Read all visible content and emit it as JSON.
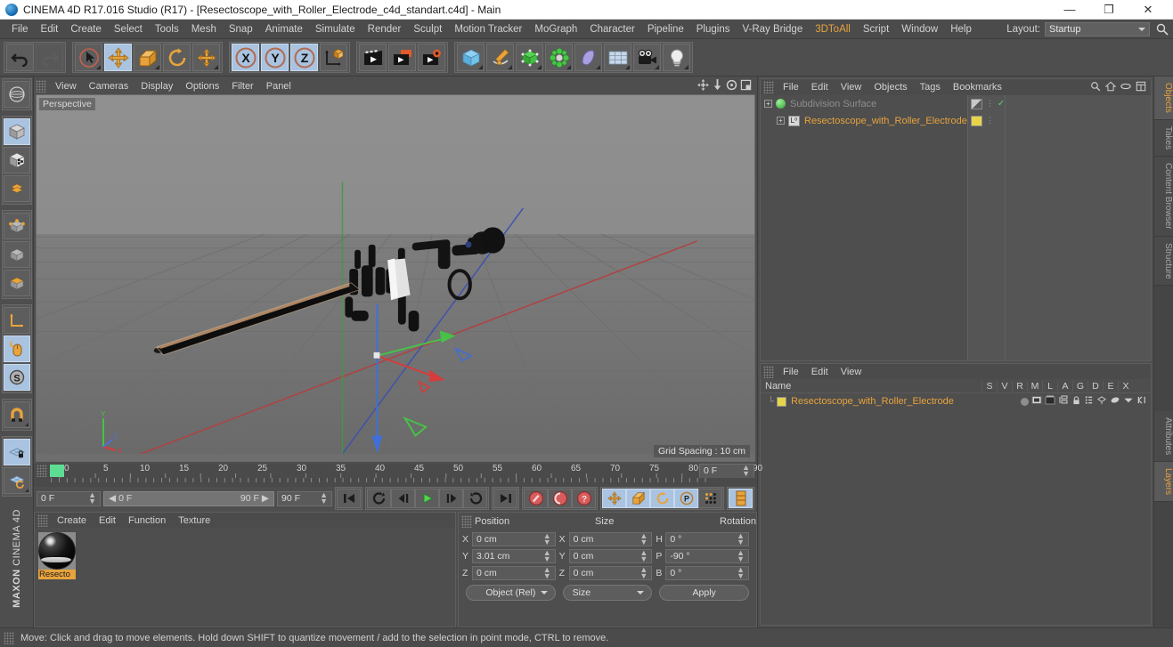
{
  "window": {
    "title": "CINEMA 4D R17.016 Studio (R17) - [Resectoscope_with_Roller_Electrode_c4d_standart.c4d] - Main",
    "minimize": "—",
    "maximize": "❐",
    "close": "✕"
  },
  "menubar": {
    "items": [
      {
        "label": "File"
      },
      {
        "label": "Edit"
      },
      {
        "label": "Create"
      },
      {
        "label": "Select"
      },
      {
        "label": "Tools"
      },
      {
        "label": "Mesh"
      },
      {
        "label": "Snap"
      },
      {
        "label": "Animate"
      },
      {
        "label": "Simulate"
      },
      {
        "label": "Render"
      },
      {
        "label": "Sculpt"
      },
      {
        "label": "Motion Tracker"
      },
      {
        "label": "MoGraph"
      },
      {
        "label": "Character"
      },
      {
        "label": "Pipeline"
      },
      {
        "label": "Plugins"
      },
      {
        "label": "V-Ray Bridge"
      },
      {
        "label": "3DToAll"
      },
      {
        "label": "Script"
      },
      {
        "label": "Window"
      },
      {
        "label": "Help"
      }
    ],
    "layout_label": "Layout:",
    "layout_value": "Startup",
    "search_icon": "search-icon"
  },
  "toolbar": {
    "undo": "undo-arrow-icon",
    "redo": "redo-arrow-icon",
    "live_select": "live-selection-icon",
    "move": "move-tool-icon",
    "scale": "scale-tool-icon",
    "rotate": "rotate-tool-icon",
    "move_alt": "move-alt-tool-icon",
    "axis_x": "X",
    "axis_y": "Y",
    "axis_z": "Z",
    "world_object": "world-object-axis-icon",
    "render_view": "render-view-icon",
    "render_region": "render-to-picture-viewer-icon",
    "render_settings": "render-settings-icon",
    "cube": "cube-primitive-icon",
    "spline": "pen-spline-icon",
    "nurbs": "generator-nurbs-icon",
    "array": "array-deformer-icon",
    "deformer": "bend-deformer-icon",
    "environment": "floor-environment-icon",
    "camera": "camera-icon",
    "light": "light-bulb-icon"
  },
  "left_rail": {
    "items": [
      {
        "name": "texture-axis-icon",
        "active": false
      },
      {
        "name": "model-mode-icon",
        "active": true
      },
      {
        "name": "texture-mode-icon",
        "active": false
      },
      {
        "name": "polygon-grid-icon",
        "active": false
      },
      {
        "name": "points-mode-icon",
        "active": false
      },
      {
        "name": "edges-mode-icon",
        "active": false
      },
      {
        "name": "polygons-mode-icon",
        "active": false
      },
      {
        "name": "object-axis-icon",
        "active": false
      },
      {
        "name": "viewport-solo-mouse-icon",
        "active": true
      },
      {
        "name": "enable-snap-s-icon",
        "active": true
      },
      {
        "name": "magnet-tool-icon",
        "active": false
      },
      {
        "name": "workplane-lock-icon",
        "active": true
      },
      {
        "name": "workplane-rotate-icon",
        "active": false
      }
    ],
    "brand_top": "MAXON",
    "brand_bottom": "CINEMA 4D"
  },
  "viewport": {
    "menus": [
      "View",
      "Cameras",
      "Display",
      "Options",
      "Filter",
      "Panel"
    ],
    "nav_icons": [
      "pan-view-icon",
      "zoom-view-icon",
      "rotate-view-icon",
      "maximize-view-icon"
    ],
    "camera_label": "Perspective",
    "grid_note": "Grid Spacing : 10 cm",
    "axis_gizmo": "axis-orientation-gizmo"
  },
  "timeline": {
    "ticks": [
      "0",
      "5",
      "10",
      "15",
      "20",
      "25",
      "30",
      "35",
      "40",
      "45",
      "50",
      "55",
      "60",
      "65",
      "70",
      "75",
      "80",
      "85",
      "90"
    ],
    "current_frame": "0 F",
    "frame_field_right": "0 F",
    "range_start": "0 F",
    "range_end": "90 F",
    "end_frame": "90 F",
    "preview_end": "90 F",
    "buttons": [
      {
        "name": "go-to-start-button",
        "glyph": "go-to-start-icon"
      },
      {
        "name": "play-backwards-loop-button",
        "glyph": "loop-back-icon"
      },
      {
        "name": "step-back-button",
        "glyph": "step-back-icon"
      },
      {
        "name": "play-button",
        "glyph": "play-icon"
      },
      {
        "name": "step-forward-button",
        "glyph": "step-forward-icon"
      },
      {
        "name": "play-forward-loop-button",
        "glyph": "loop-forward-icon"
      },
      {
        "name": "go-to-end-button",
        "glyph": "go-to-end-icon"
      },
      {
        "name": "record-active-objects-button",
        "glyph": "record-key-icon"
      },
      {
        "name": "autokeying-button",
        "glyph": "autokey-icon"
      },
      {
        "name": "keyframe-selection-button",
        "glyph": "keyframe-question-icon"
      },
      {
        "name": "position-key-button",
        "glyph": "position-key-icon"
      },
      {
        "name": "scale-key-button",
        "glyph": "scale-key-icon"
      },
      {
        "name": "rotation-key-button",
        "glyph": "rotation-key-icon"
      },
      {
        "name": "param-key-button",
        "glyph": "parameter-key-icon"
      },
      {
        "name": "point-level-animation-button",
        "glyph": "pla-dots-icon"
      },
      {
        "name": "timeline-layout-button",
        "glyph": "timeline-toggle-icon"
      }
    ]
  },
  "materials": {
    "menus": [
      "Create",
      "Edit",
      "Function",
      "Texture"
    ],
    "items": [
      {
        "name": "Resecto",
        "preview": "black-glossy-sphere"
      }
    ]
  },
  "coordinates": {
    "columns": [
      "Position",
      "Size",
      "Rotation"
    ],
    "position": [
      {
        "axis": "X",
        "value": "0 cm"
      },
      {
        "axis": "Y",
        "value": "3.01 cm"
      },
      {
        "axis": "Z",
        "value": "0 cm"
      }
    ],
    "size": [
      {
        "axis": "X",
        "value": "0 cm"
      },
      {
        "axis": "Y",
        "value": "0 cm"
      },
      {
        "axis": "Z",
        "value": "0 cm"
      }
    ],
    "rotation": [
      {
        "axis": "H",
        "value": "0 °"
      },
      {
        "axis": "P",
        "value": "-90 °"
      },
      {
        "axis": "B",
        "value": "0 °"
      }
    ],
    "mode_left": "Object (Rel)",
    "mode_mid": "Size",
    "apply": "Apply"
  },
  "object_manager": {
    "menus": [
      "File",
      "Edit",
      "View",
      "Objects",
      "Tags",
      "Bookmarks"
    ],
    "header_icons": [
      "search-icon",
      "home-icon",
      "link-icon",
      "expand-icon"
    ],
    "rows": [
      {
        "name": "Subdivision Surface",
        "selected": false,
        "icon_color": "#4ad34a",
        "tag": "checkerboard-tag",
        "check": "✓"
      },
      {
        "name": "Resectoscope_with_Roller_Electrode",
        "selected": true,
        "icon_color": "#e8e8e8",
        "tag": "material-tag-yellow",
        "check": ""
      }
    ]
  },
  "layers_panel": {
    "menus": [
      "File",
      "Edit",
      "View"
    ],
    "name_column": "Name",
    "flags": [
      "S",
      "V",
      "R",
      "M",
      "L",
      "A",
      "G",
      "D",
      "E",
      "X"
    ],
    "rows": [
      {
        "name": "Resectoscope_with_Roller_Electrode",
        "swatch": "#e8d44a"
      }
    ]
  },
  "right_tabs": {
    "top": [
      {
        "label": "Objects",
        "active": true
      },
      {
        "label": "Takes",
        "active": false
      },
      {
        "label": "Content Browser",
        "active": false
      },
      {
        "label": "Structure",
        "active": false
      }
    ],
    "bottom": [
      {
        "label": "Attributes",
        "active": false
      },
      {
        "label": "Layers",
        "active": true
      }
    ]
  },
  "statusbar": {
    "text": "Move: Click and drag to move elements. Hold down SHIFT to quantize movement / add to the selection in point mode, CTRL to remove."
  },
  "colors": {
    "accent_orange": "#e8a33d",
    "panel_bg": "#4e4e4e",
    "toolbar_active": "#a9c3e0",
    "axis_x": "#d23b3b",
    "axis_y": "#3bd23b",
    "axis_z": "#3b5bd2"
  }
}
